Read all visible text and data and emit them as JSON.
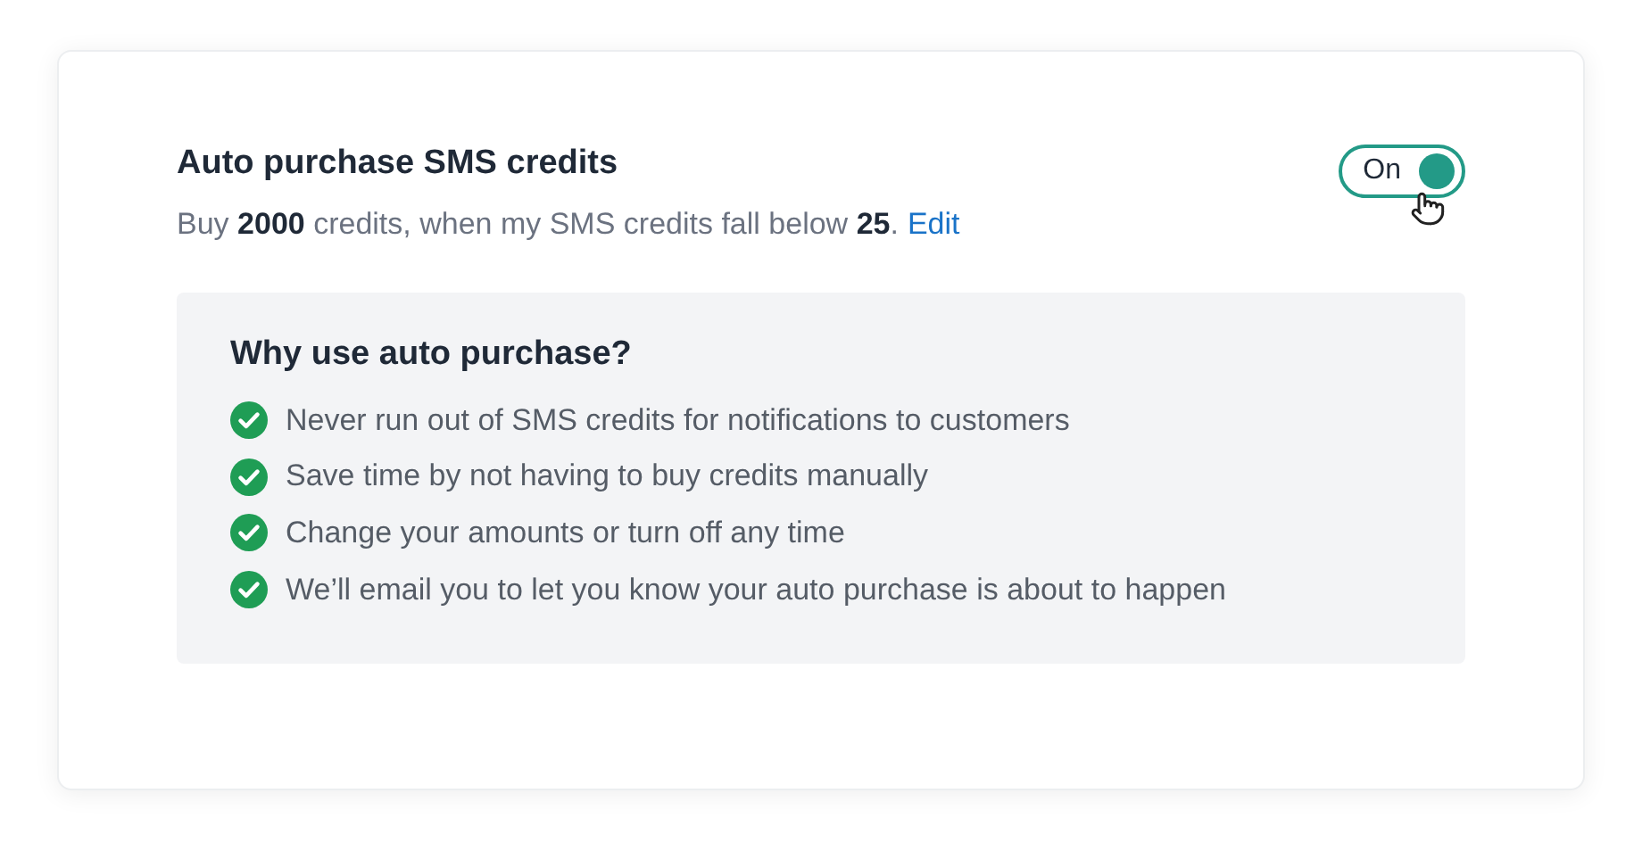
{
  "setting": {
    "title": "Auto purchase SMS credits",
    "description": "Buy **2000** credits, when my SMS credits fall below **25**.",
    "link": "Edit",
    "toggle": {
      "label": "On",
      "on": true
    }
  },
  "info": {
    "heading": "Why use auto purchase?",
    "items": [
      {
        "text": "Never run out of SMS credits for notifications to customers"
      },
      {
        "text": "Save time by not having to buy credits manually"
      },
      {
        "text": "Change your amounts or turn off any time"
      },
      {
        "text": "We’ll email you to let you know your auto purchase is about to happen"
      }
    ]
  }
}
